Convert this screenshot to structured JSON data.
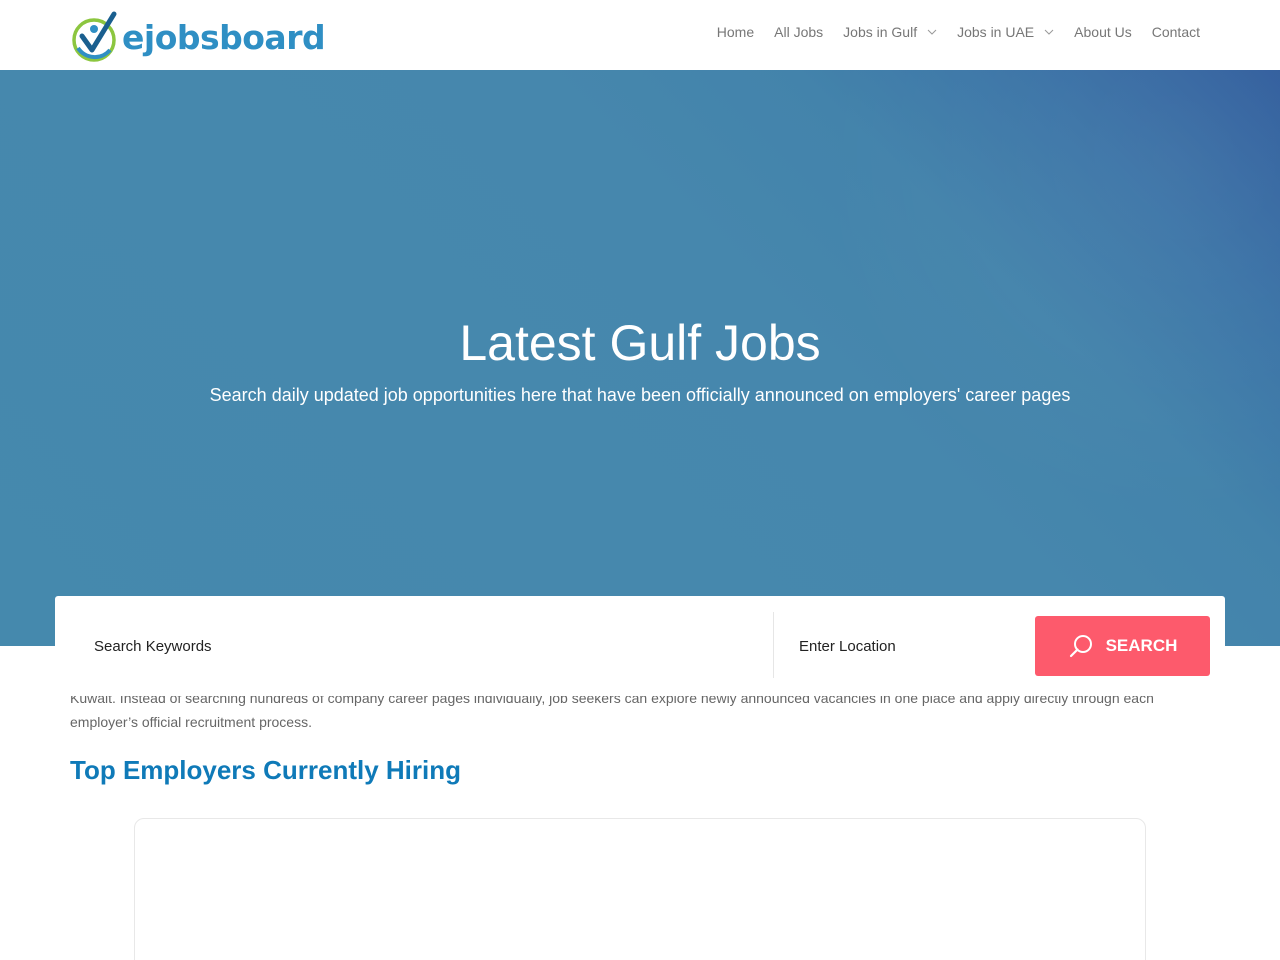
{
  "brand": {
    "name": "ejobsboard",
    "accent": "#2f8fc4",
    "logo_icon": "checkmark-person-logo"
  },
  "nav": {
    "items": [
      {
        "label": "Home",
        "dropdown": false
      },
      {
        "label": "All Jobs",
        "dropdown": false
      },
      {
        "label": "Jobs in Gulf",
        "dropdown": true
      },
      {
        "label": "Jobs in UAE",
        "dropdown": true
      },
      {
        "label": "About Us",
        "dropdown": false
      },
      {
        "label": "Contact",
        "dropdown": false
      }
    ]
  },
  "hero": {
    "title": "Latest Gulf Jobs",
    "subtitle": "Search daily updated job opportunities here that have been officially announced on employers' career pages"
  },
  "search": {
    "keywords_placeholder": "Search Keywords",
    "location_placeholder": "Enter Location",
    "button_label": "SEARCH",
    "button_icon": "search-icon",
    "button_color": "#fd5a6c"
  },
  "content": {
    "intro_text": "Kuwait. Instead of searching hundreds of company career pages individually, job seekers can explore newly announced vacancies in one place and apply directly through each employer’s official recruitment process.",
    "section_title": "Top Employers Currently Hiring",
    "section_title_color": "#0f7ab8"
  }
}
